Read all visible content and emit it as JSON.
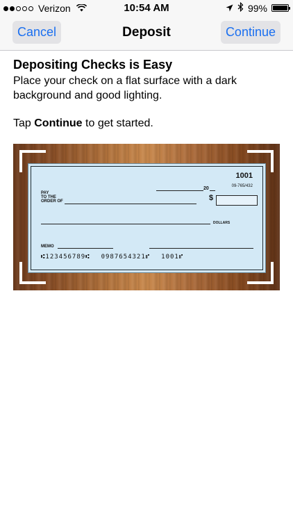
{
  "status_bar": {
    "carrier": "Verizon",
    "time": "10:54 AM",
    "battery": "99%",
    "signal_bars_filled": 2,
    "signal_bars_total": 5,
    "battery_level": 0.99
  },
  "nav": {
    "cancel_label": "Cancel",
    "title": "Deposit",
    "continue_label": "Continue"
  },
  "content": {
    "heading": "Depositing Checks is Easy",
    "instructions": "Place your check on a flat surface with a dark background and good lighting.",
    "tap_prefix": "Tap ",
    "tap_bold": "Continue",
    "tap_suffix": " to get started."
  },
  "check": {
    "number": "1001",
    "routing_fraction": "09-765/432",
    "year_prefix": "20",
    "pay_to_line1": "PAY",
    "pay_to_line2": "TO THE",
    "pay_to_line3": "ORDER OF",
    "dollar_sign": "$",
    "dollars_label": "DOLLARS",
    "memo_label": "MEMO",
    "micr_routing": "⑆123456789⑆",
    "micr_account": "0987654321⑈",
    "micr_check": "1001⑈"
  },
  "icons": [
    "signal-dots",
    "wifi-icon",
    "location-arrow-icon",
    "bluetooth-icon",
    "battery-icon"
  ],
  "colors": {
    "accent": "#1a6ff0",
    "nav_background": "#f7f7f7",
    "button_background": "#e3e3e6",
    "check_paper": "#d3e9f6"
  }
}
